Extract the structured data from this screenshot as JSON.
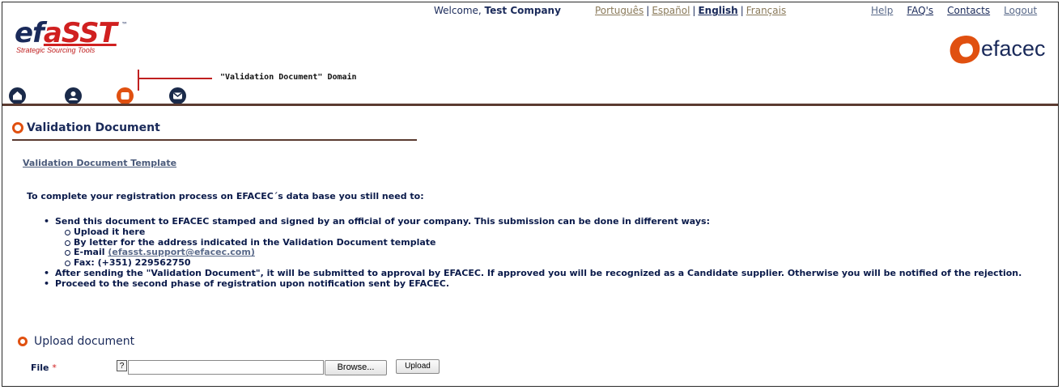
{
  "header": {
    "welcome_prefix": "Welcome, ",
    "welcome_user": "Test Company",
    "languages": [
      {
        "label": "Português"
      },
      {
        "label": "Español"
      },
      {
        "label": "English"
      },
      {
        "label": "Français"
      }
    ],
    "language_sep": "|",
    "links": {
      "help": "Help",
      "faqs": "FAQ's",
      "contacts": "Contacts",
      "logout": "Logout"
    }
  },
  "logo": {
    "efasst_ef": "ef",
    "efasst_a": "a",
    "efasst_sst": "SST",
    "efasst_tm": "™",
    "efasst_tagline": "Strategic Sourcing Tools",
    "efacec": "efacec"
  },
  "annotation": "\"Validation Document\" Domain",
  "nav": {
    "icons": [
      "home-icon",
      "user-icon",
      "document-icon",
      "mail-icon"
    ],
    "active_color": "#e05010",
    "inactive_color": "#1a2a4a"
  },
  "section": {
    "title": "Validation Document",
    "template_link": "Validation Document Template",
    "intro": "To complete your registration process on EFACEC´s data base you still need to:",
    "bullet1": "Send this document to EFACEC stamped and signed by an official of your company. This submission can be done in different ways:",
    "sub1": "Upload it here",
    "sub2": "By letter for the address indicated in the Validation Document template",
    "sub3_prefix": "E-mail ",
    "sub3_link": "(efasst.support@efacec.com)",
    "sub4": "Fax: (+351) 229562750",
    "bullet2": "After sending the \"Validation Document\", it will be submitted to approval by EFACEC. If approved you will be recognized as a Candidate supplier. Otherwise you will be notified of the rejection.",
    "bullet3": "Proceed to the second phase of registration upon notification sent by EFACEC."
  },
  "upload": {
    "title": "Upload document",
    "file_label": "File",
    "required_mark": "*",
    "help": "?",
    "file_value": "",
    "browse": "Browse...",
    "upload": "Upload"
  },
  "colors": {
    "accent": "#e05010",
    "navy": "#1a2a5a",
    "divider": "#5a3a30",
    "annotation": "#c02020"
  }
}
